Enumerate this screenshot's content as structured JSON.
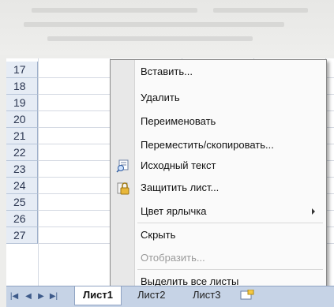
{
  "rows": [
    "17",
    "18",
    "19",
    "20",
    "21",
    "22",
    "23",
    "24",
    "25",
    "26",
    "27"
  ],
  "menu": {
    "items": [
      {
        "label": "Вставить...",
        "enabled": true,
        "icon": "",
        "submenu": false
      },
      {
        "label": "Удалить",
        "enabled": true,
        "icon": "",
        "submenu": false
      },
      {
        "label": "Переименовать",
        "enabled": true,
        "icon": "",
        "submenu": false
      },
      {
        "label": "Переместить/скопировать...",
        "enabled": true,
        "icon": "",
        "submenu": false
      },
      {
        "label": "Исходный текст",
        "enabled": true,
        "icon": "view-code-icon",
        "submenu": false
      },
      {
        "label": "Защитить лист...",
        "enabled": true,
        "icon": "lock-icon",
        "submenu": false
      },
      {
        "label": "Цвет ярлычка",
        "enabled": true,
        "icon": "",
        "submenu": true
      },
      {
        "label": "Скрыть",
        "enabled": true,
        "icon": "",
        "submenu": false
      },
      {
        "label": "Отобразить...",
        "enabled": false,
        "icon": "",
        "submenu": false
      },
      {
        "label": "Выделить все листы",
        "enabled": true,
        "icon": "",
        "submenu": false
      }
    ]
  },
  "tabs": [
    {
      "label": "Лист1",
      "active": true
    },
    {
      "label": "Лист2",
      "active": false
    },
    {
      "label": "Лист3",
      "active": false
    }
  ],
  "nav_buttons": [
    "first-sheet-icon",
    "prev-sheet-icon",
    "next-sheet-icon",
    "last-sheet-icon"
  ],
  "colors": {
    "menu_bg": "#fafafa",
    "tabbar": "#c6d3e6",
    "rowheader": "#e6ecf5",
    "disabled_text": "#9a9a9a"
  }
}
